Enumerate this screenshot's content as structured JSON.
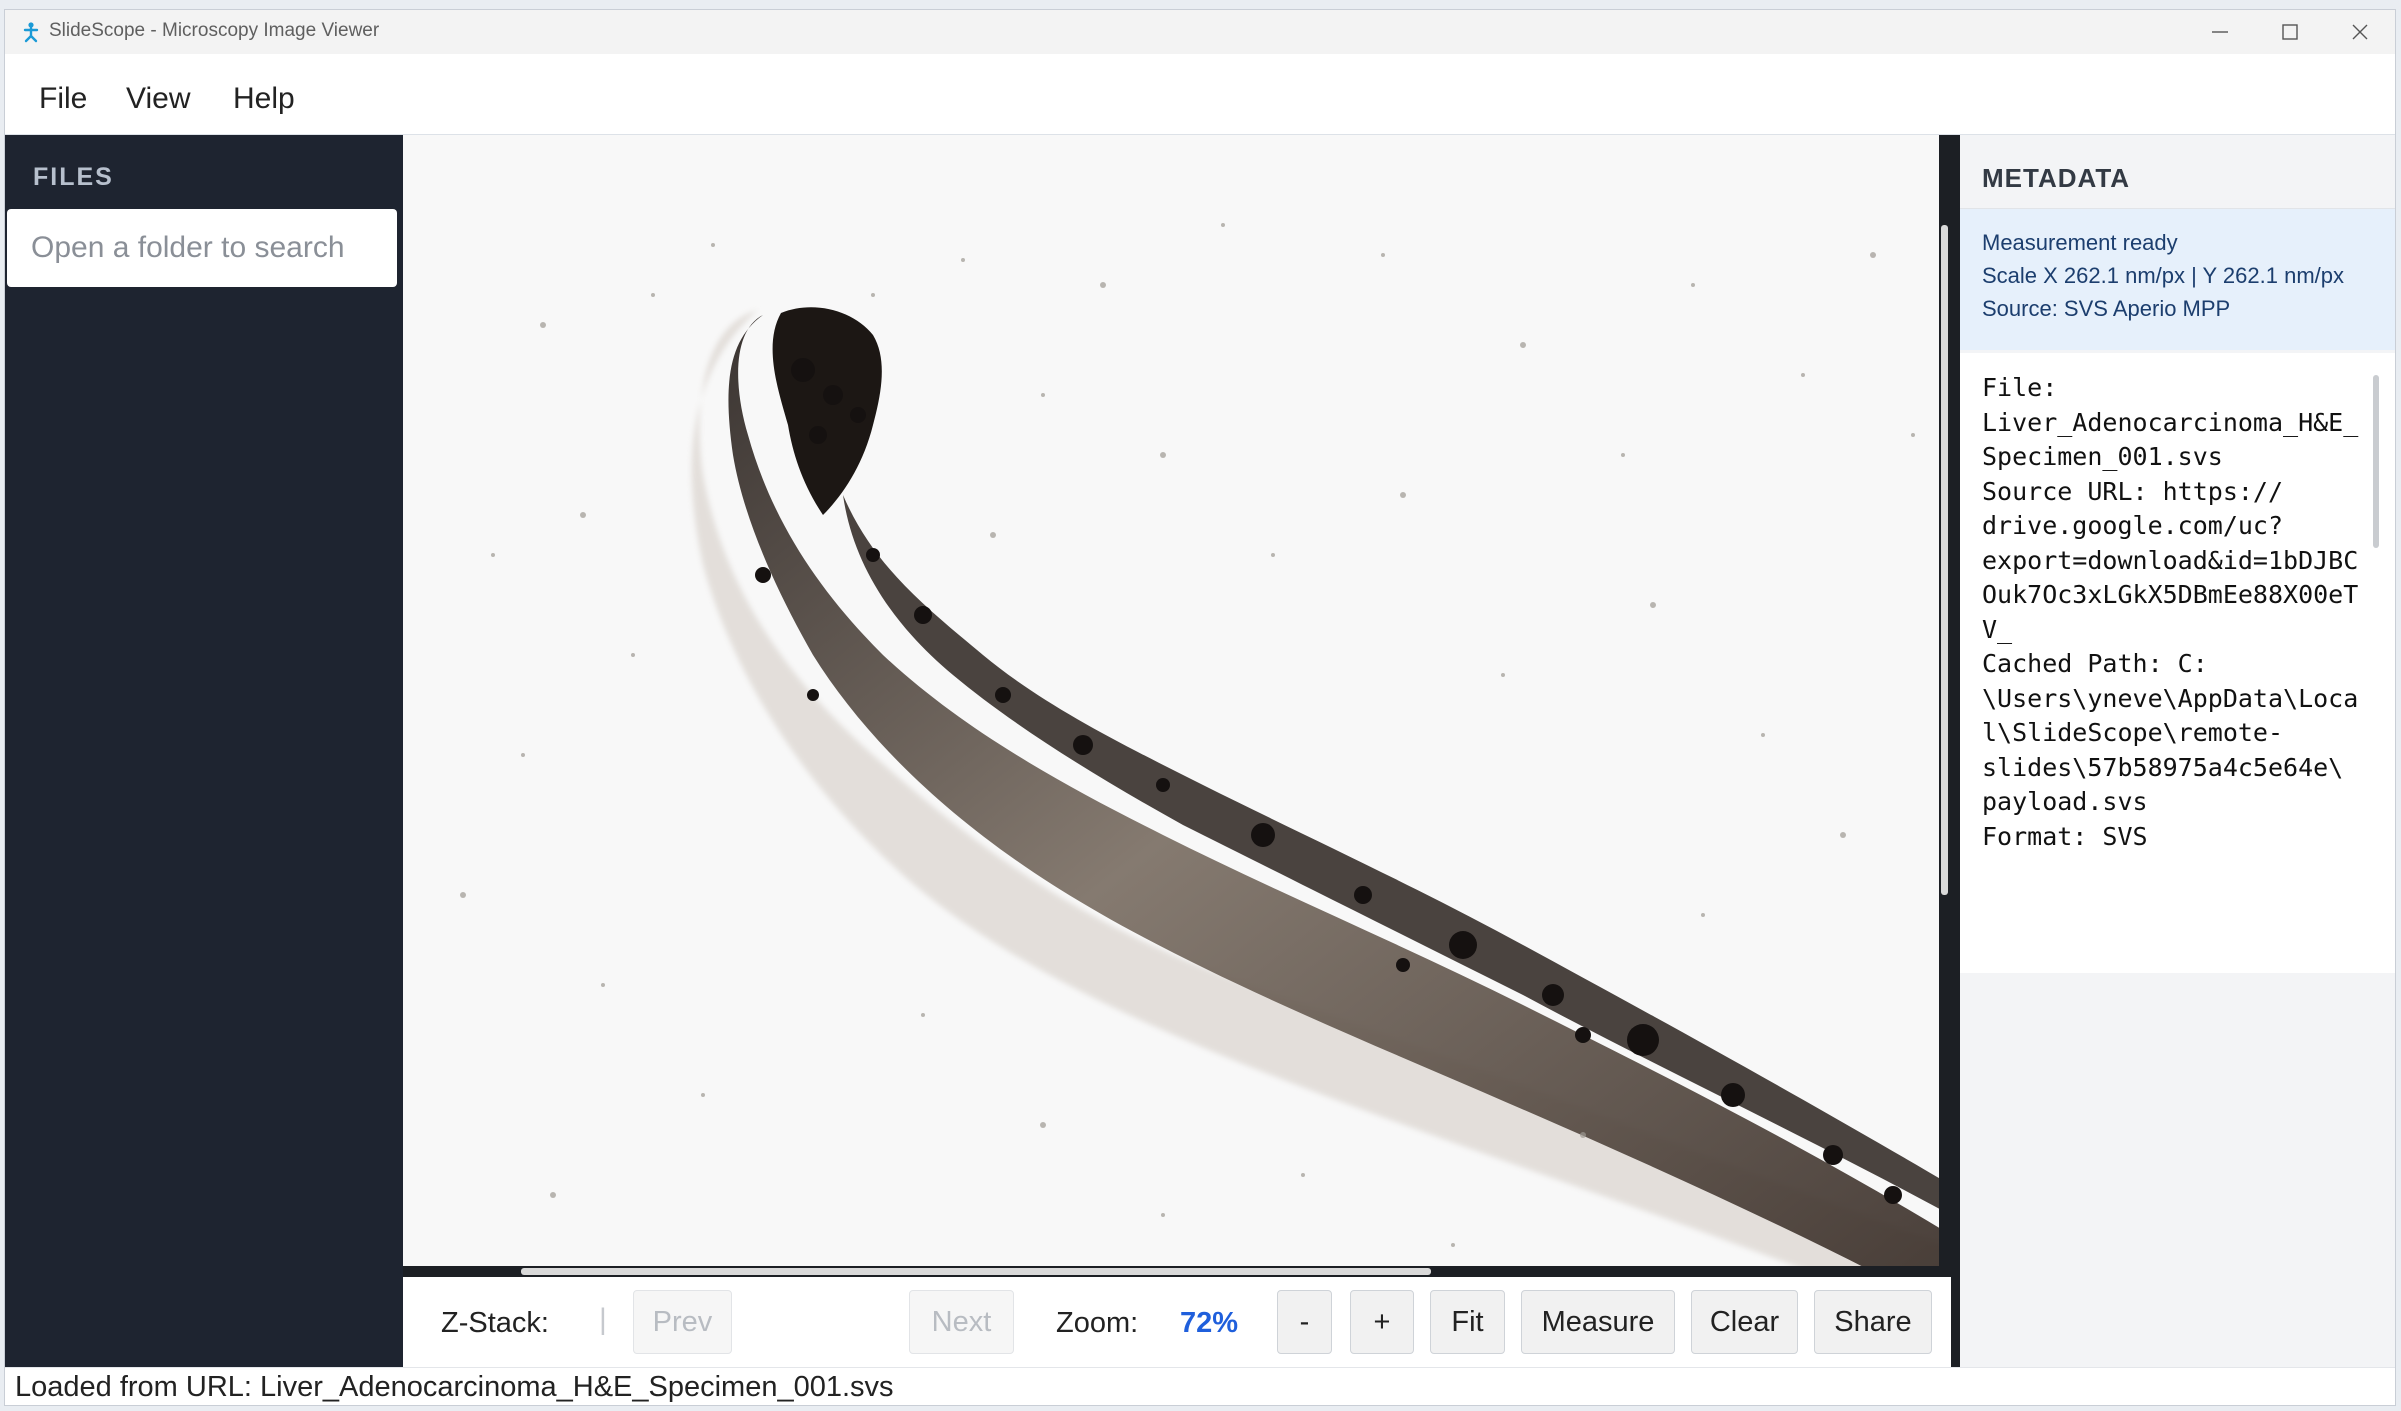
{
  "window": {
    "title": "SlideScope - Microscopy Image Viewer",
    "icon": "slidescope-logo-icon"
  },
  "menu": {
    "items": [
      "File",
      "View",
      "Help"
    ]
  },
  "sidebar": {
    "title": "FILES",
    "search": {
      "placeholder": "Open a folder to search",
      "value": ""
    }
  },
  "viewer": {
    "image_subject": "tissue-specimen-slide"
  },
  "toolbar": {
    "zstack_label": "Z-Stack:",
    "zstack_separator": "|",
    "prev_label": "Prev",
    "next_label": "Next",
    "zoom_label": "Zoom:",
    "zoom_value": "72%",
    "zoom_out_label": "-",
    "zoom_in_label": "+",
    "fit_label": "Fit",
    "measure_label": "Measure",
    "clear_label": "Clear",
    "share_label": "Share"
  },
  "metadata": {
    "title": "METADATA",
    "status": "Measurement ready",
    "scale": "Scale X 262.1 nm/px | Y 262.1 nm/px",
    "source": "Source: SVS Aperio MPP",
    "details": "File:\nLiver_Adenocarcinoma_H&E_Specimen_001.svs\nSource URL: https://\ndrive.google.com/uc?\nexport=download&id=1bDJBCOuk7Oc3xLGkX5DBmEe88X00eTV_\nCached Path: C:\n\\Users\\yneve\\AppData\\Local\\SlideScope\\remote-\nslides\\57b58975a4c5e64e\\\npayload.svs\nFormat: SVS"
  },
  "status_bar": {
    "text": "Loaded from URL: Liver_Adenocarcinoma_H&E_Specimen_001.svs"
  },
  "colors": {
    "sidebar_bg": "#1e2430",
    "accent_zoom": "#1f5fdc",
    "metadata_info_bg": "#e6f0fb"
  }
}
